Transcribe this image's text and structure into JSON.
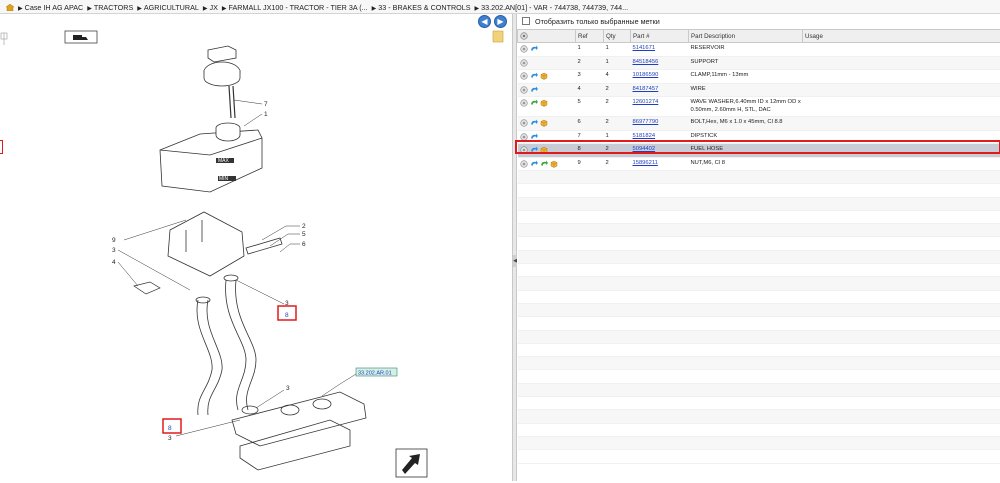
{
  "breadcrumb": [
    "Case IH AG APAC",
    "TRACTORS",
    "AGRICULTURAL",
    "JX",
    "FARMALL JX100 - TRACTOR - TIER 3A (...",
    "33 - BRAKES & CONTROLS",
    "33.202.AN[01] - VAR - 744738, 744739, 744..."
  ],
  "nav": {
    "back_glyph": "◀",
    "forward_glyph": "▶"
  },
  "filter": {
    "label": "Отобразить только выбранные метки",
    "checked": false
  },
  "table": {
    "headers": {
      "ref": "Ref",
      "qty": "Qty",
      "part": "Part #",
      "desc": "Part Description",
      "usage": "Usage"
    },
    "rows": [
      {
        "ref": "1",
        "qty": "1",
        "part": "5141671",
        "desc": "RESERVOIR",
        "icons": [
          "info",
          "arrow-blue"
        ]
      },
      {
        "ref": "2",
        "qty": "1",
        "part": "84518456",
        "desc": "SUPPORT",
        "icons": [
          "info"
        ]
      },
      {
        "ref": "3",
        "qty": "4",
        "part": "10186590",
        "desc": "CLAMP,11mm - 13mm",
        "icons": [
          "info",
          "arrow-blue",
          "box"
        ]
      },
      {
        "ref": "4",
        "qty": "2",
        "part": "84187457",
        "desc": "WIRE",
        "icons": [
          "info",
          "arrow-blue"
        ]
      },
      {
        "ref": "5",
        "qty": "2",
        "part": "12601274",
        "desc": "WAVE WASHER,6.40mm ID x 12mm OD x 0.50mm, 2.60mm H, STL, DAC",
        "icons": [
          "info",
          "arrow-green",
          "box"
        ]
      },
      {
        "ref": "6",
        "qty": "2",
        "part": "86977790",
        "desc": "BOLT,Hex, M6 x 1.0 x 45mm, Cl 8.8",
        "icons": [
          "info",
          "arrow-blue",
          "box"
        ]
      },
      {
        "ref": "7",
        "qty": "1",
        "part": "5181824",
        "desc": "DIPSTICK",
        "icons": [
          "info",
          "arrow-blue"
        ]
      },
      {
        "ref": "8",
        "qty": "2",
        "part": "5094402",
        "desc": "FUEL HOSE",
        "icons": [
          "info",
          "arrow-blue",
          "box"
        ],
        "selected": true
      },
      {
        "ref": "9",
        "qty": "2",
        "part": "15896211",
        "desc": "NUT,M6, Cl 8",
        "icons": [
          "info",
          "arrow-blue",
          "arrow-green",
          "box"
        ]
      }
    ]
  },
  "diagram": {
    "callouts": [
      "7",
      "1",
      "9",
      "3",
      "4",
      "2",
      "5",
      "6",
      "3",
      "8",
      "3",
      "8",
      "3"
    ],
    "ref_tag": "33.202.AR.01",
    "minmax": {
      "max": "MAX",
      "min": "MIN"
    }
  },
  "colors": {
    "highlight": "#e01b1b",
    "selected_row": "#c7ccd6",
    "link": "#1f3fbf",
    "nav_btn": "#3f7fd0"
  }
}
